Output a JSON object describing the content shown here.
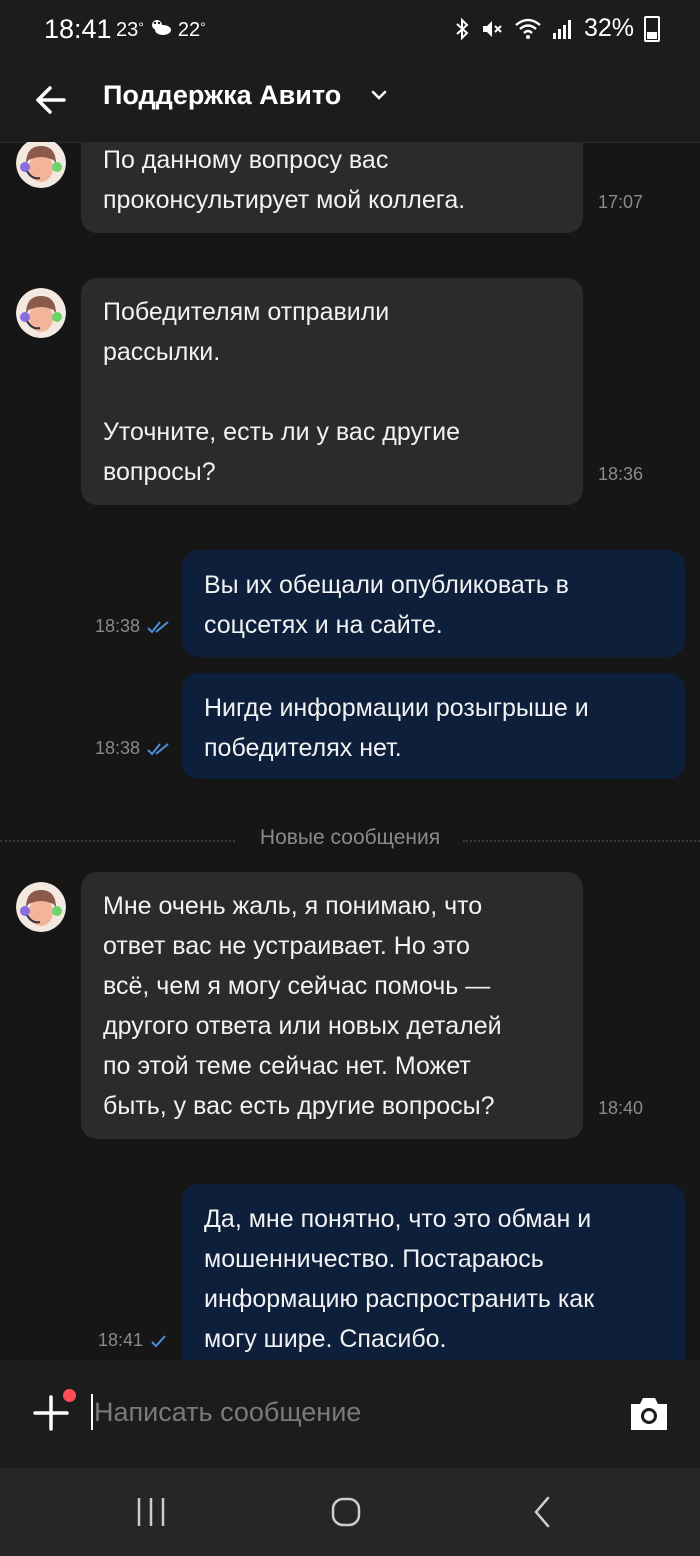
{
  "status_bar": {
    "time": "18:41",
    "weather_1": "23",
    "weather_2": "22",
    "battery": "32%"
  },
  "header": {
    "title": "Поддержка Авито"
  },
  "messages": [
    {
      "side": "in",
      "text": "По данному вопросу вас\nпроконсультирует мой коллега.",
      "time": "17:07"
    },
    {
      "side": "in",
      "text": "Победителям отправили\nрассылки.\n\nУточните, есть ли у вас другие\nвопросы?",
      "time": "18:36"
    },
    {
      "side": "out",
      "text": "Вы их обещали опубликовать в\nсоцсетях и на сайте.",
      "time": "18:38"
    },
    {
      "side": "out",
      "text": "Нигде информации розыгрыше и\nпобедителях нет.",
      "time": "18:38"
    },
    {
      "side": "in",
      "text": "Мне очень жаль, я понимаю, что\nответ вас не устраивает. Но это\nвсё, чем я могу сейчас помочь —\nдругого ответа или новых деталей\nпо этой теме сейчас нет. Может\nбыть, у вас есть другие вопросы?",
      "time": "18:40"
    },
    {
      "side": "out",
      "text": "Да, мне понятно, что это обман и\nмошенничество. Постараюсь\nинформацию распространить как\nмогу шире. Спасибо.",
      "time": "18:41"
    }
  ],
  "divider_label": "Новые сообщения",
  "composer": {
    "placeholder": "Написать сообщение"
  },
  "colors": {
    "background": "#161616",
    "incoming_bubble": "#2b2b2b",
    "outgoing_bubble": "#0d1f3a",
    "read_check": "#4a90d9",
    "notification_dot": "#ff4d5a"
  }
}
